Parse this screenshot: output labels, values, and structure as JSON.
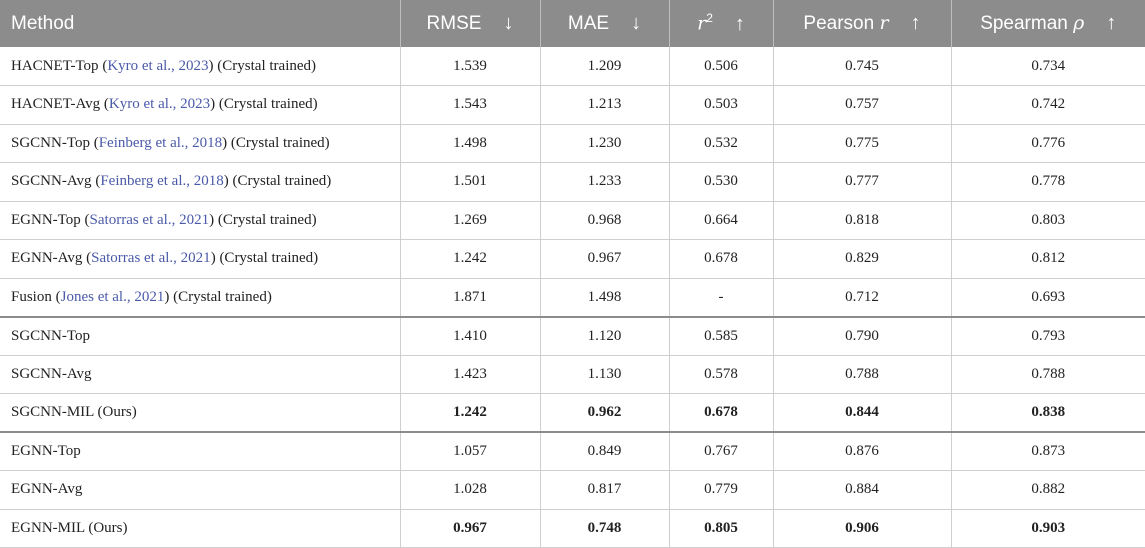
{
  "header": {
    "method": "Method",
    "rmse": "RMSE",
    "mae": "MAE",
    "r2_base": "r",
    "r2_sup": "2",
    "pearson": "Pearson",
    "pearson_sym": "r",
    "spearman": "Spearman",
    "spearman_sym": "ρ",
    "down_arrow": "↓",
    "up_arrow": "↑"
  },
  "rows": [
    {
      "name": "HACNET-Top",
      "cite": "Kyro et al., 2023",
      "suffix": "(Crystal trained)",
      "rmse": "1.539",
      "mae": "1.209",
      "r2": "0.506",
      "pearson": "0.745",
      "spearman": "0.734"
    },
    {
      "name": "HACNET-Avg",
      "cite": "Kyro et al., 2023",
      "suffix": "(Crystal trained)",
      "rmse": "1.543",
      "mae": "1.213",
      "r2": "0.503",
      "pearson": "0.757",
      "spearman": "0.742"
    },
    {
      "name": "SGCNN-Top",
      "cite": "Feinberg et al., 2018",
      "suffix": "(Crystal trained)",
      "rmse": "1.498",
      "mae": "1.230",
      "r2": "0.532",
      "pearson": "0.775",
      "spearman": "0.776"
    },
    {
      "name": "SGCNN-Avg",
      "cite": "Feinberg et al., 2018",
      "suffix": "(Crystal trained)",
      "rmse": "1.501",
      "mae": "1.233",
      "r2": "0.530",
      "pearson": "0.777",
      "spearman": "0.778"
    },
    {
      "name": "EGNN-Top",
      "cite": "Satorras et al., 2021",
      "suffix": "(Crystal trained)",
      "rmse": "1.269",
      "mae": "0.968",
      "r2": "0.664",
      "pearson": "0.818",
      "spearman": "0.803"
    },
    {
      "name": "EGNN-Avg",
      "cite": "Satorras et al., 2021",
      "suffix": "(Crystal trained)",
      "rmse": "1.242",
      "mae": "0.967",
      "r2": "0.678",
      "pearson": "0.829",
      "spearman": "0.812"
    },
    {
      "name": "Fusion",
      "cite": "Jones et al., 2021",
      "suffix": "(Crystal trained)",
      "rmse": "1.871",
      "mae": "1.498",
      "r2": "-",
      "pearson": "0.712",
      "spearman": "0.693"
    },
    {
      "name": "SGCNN-Top",
      "cite": "",
      "suffix": "",
      "rmse": "1.410",
      "mae": "1.120",
      "r2": "0.585",
      "pearson": "0.790",
      "spearman": "0.793"
    },
    {
      "name": "SGCNN-Avg",
      "cite": "",
      "suffix": "",
      "rmse": "1.423",
      "mae": "1.130",
      "r2": "0.578",
      "pearson": "0.788",
      "spearman": "0.788"
    },
    {
      "name": "SGCNN-MIL (Ours)",
      "cite": "",
      "suffix": "",
      "rmse": "1.242",
      "mae": "0.962",
      "r2": "0.678",
      "pearson": "0.844",
      "spearman": "0.838"
    },
    {
      "name": "EGNN-Top",
      "cite": "",
      "suffix": "",
      "rmse": "1.057",
      "mae": "0.849",
      "r2": "0.767",
      "pearson": "0.876",
      "spearman": "0.873"
    },
    {
      "name": "EGNN-Avg",
      "cite": "",
      "suffix": "",
      "rmse": "1.028",
      "mae": "0.817",
      "r2": "0.779",
      "pearson": "0.884",
      "spearman": "0.882"
    },
    {
      "name": "EGNN-MIL (Ours)",
      "cite": "",
      "suffix": "",
      "rmse": "0.967",
      "mae": "0.748",
      "r2": "0.805",
      "pearson": "0.906",
      "spearman": "0.903"
    }
  ]
}
